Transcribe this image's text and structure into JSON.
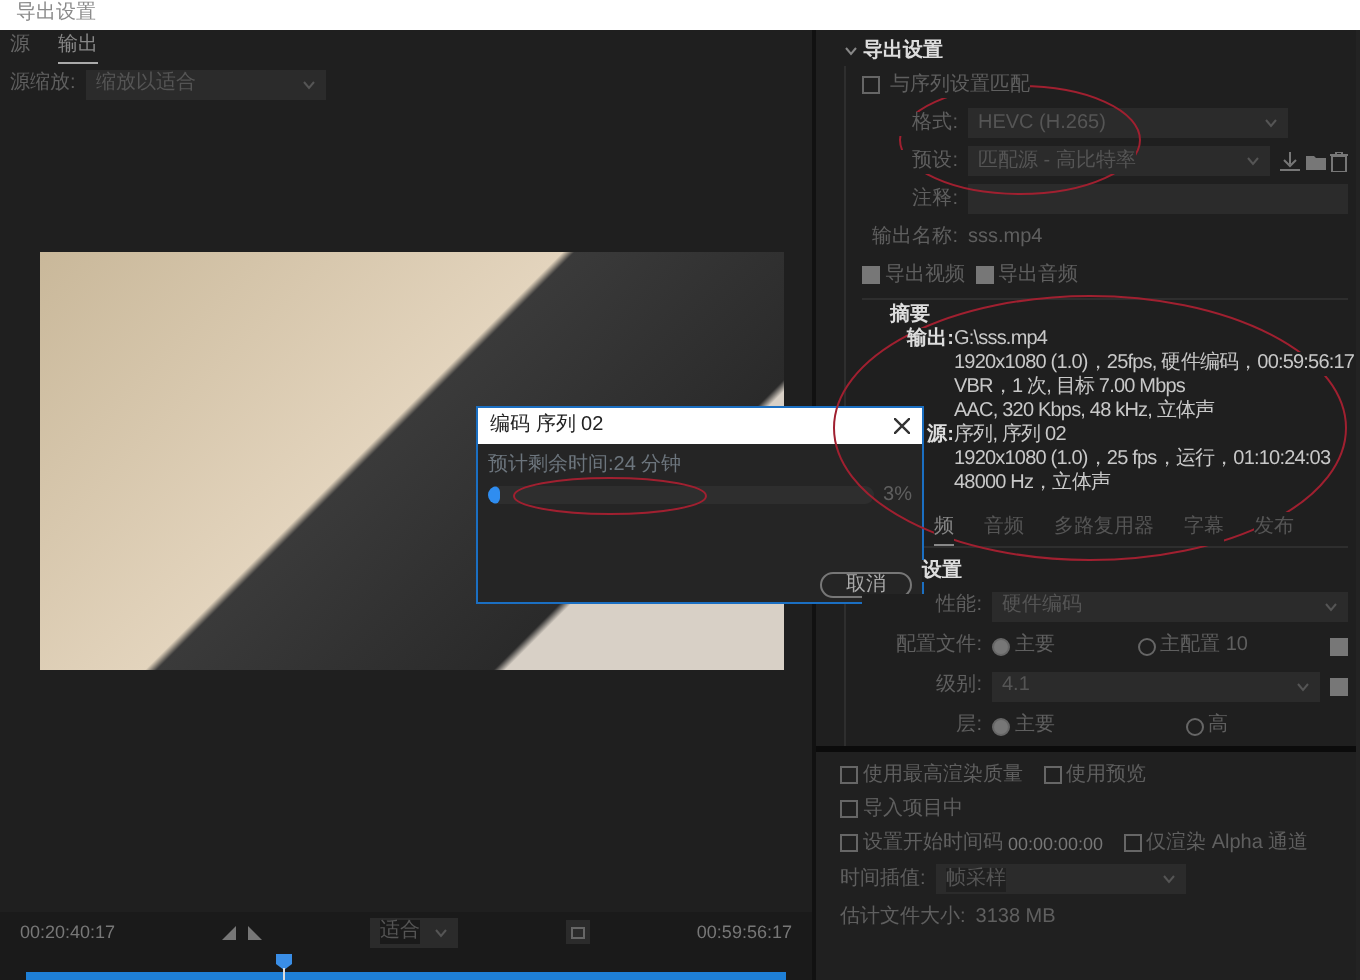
{
  "window": {
    "title": "导出设置"
  },
  "source_panel": {
    "tabs": [
      {
        "label": "源",
        "selected": false
      },
      {
        "label": "输出",
        "selected": true
      }
    ],
    "scaling_label": "源缩放:",
    "scaling_value": "缩放以适合"
  },
  "timeline": {
    "start_time": "00:20:40:17",
    "zoom_value": "适合",
    "end_time": "00:59:56:17",
    "playhead": {
      "level": 0.34
    }
  },
  "export_settings": {
    "title": "导出设置",
    "expanded": true,
    "match_sequence": {
      "label": "与序列设置匹配",
      "checked": false
    },
    "fields": [
      {
        "kind": "dropdown",
        "label": "格式:",
        "value": "HEVC (H.265)"
      },
      {
        "kind": "preset",
        "label": "预设:",
        "value": "匹配源 - 高比特率"
      },
      {
        "kind": "input",
        "label": "注释:"
      }
    ],
    "output_name_label": "输出名称:",
    "output_name": "sss.mp4",
    "export_checks": [
      {
        "label": "导出视频",
        "checked": true
      },
      {
        "label": "导出音频",
        "checked": true
      }
    ]
  },
  "summary": {
    "title": "摘要",
    "groups": [
      {
        "label": "输出:",
        "lines": [
          "G:\\sss.mp4",
          "1920x1080 (1.0)，25fps, 硬件编码，00:59:56:17",
          "VBR，1 次, 目标 7.00 Mbps",
          "AAC, 320 Kbps, 48  kHz, 立体声"
        ]
      },
      {
        "label": "源:",
        "lines": [
          "序列, 序列 02",
          "1920x1080 (1.0)，25 fps，运行，01:10:24:03",
          "48000 Hz，立体声"
        ]
      }
    ]
  },
  "settings_tabs": [
    {
      "label": "频",
      "selected": true
    },
    {
      "label": "音频",
      "selected": false
    },
    {
      "label": "多路复用器",
      "selected": false
    },
    {
      "label": "字幕",
      "selected": false
    },
    {
      "label": "发布",
      "selected": false
    }
  ],
  "video_settings": {
    "title": "设置",
    "rows": [
      {
        "kind": "dropdown",
        "label": "性能:",
        "value": "硬件编码"
      },
      {
        "kind": "radio",
        "label": "配置文件:",
        "options": [
          {
            "label": "主要",
            "selected": true
          },
          {
            "label": "主配置 10",
            "selected": false
          }
        ],
        "checkbox": {
          "checked": true
        }
      },
      {
        "kind": "dropdown",
        "label": "级别:",
        "value": "4.1",
        "checkbox": {
          "checked": true
        }
      },
      {
        "kind": "radio",
        "label": "层:",
        "options": [
          {
            "label": "主要",
            "selected": true
          },
          {
            "label": "高",
            "selected": false
          }
        ]
      }
    ]
  },
  "option_rows": [
    [
      {
        "label": "使用最高渲染质量",
        "checked": false
      },
      {
        "label": "使用预览",
        "checked": false
      }
    ],
    [
      {
        "label": "导入项目中",
        "checked": false
      }
    ],
    [
      {
        "label": "设置开始时间码",
        "value": "00:00:00:00",
        "checked": false
      },
      {
        "label": "仅渲染 Alpha 通道",
        "checked": false
      }
    ]
  ],
  "time_interpolation": {
    "label": "时间插值:",
    "value": "帧采样"
  },
  "file_size": {
    "label": "估计文件大小:",
    "value": "3138 MB"
  },
  "dialog": {
    "title": "编码 序列 02",
    "remaining": "预计剩余时间:24 分钟",
    "progress": {
      "level": 0.03
    },
    "percent": "3%",
    "cancel": "取消"
  }
}
